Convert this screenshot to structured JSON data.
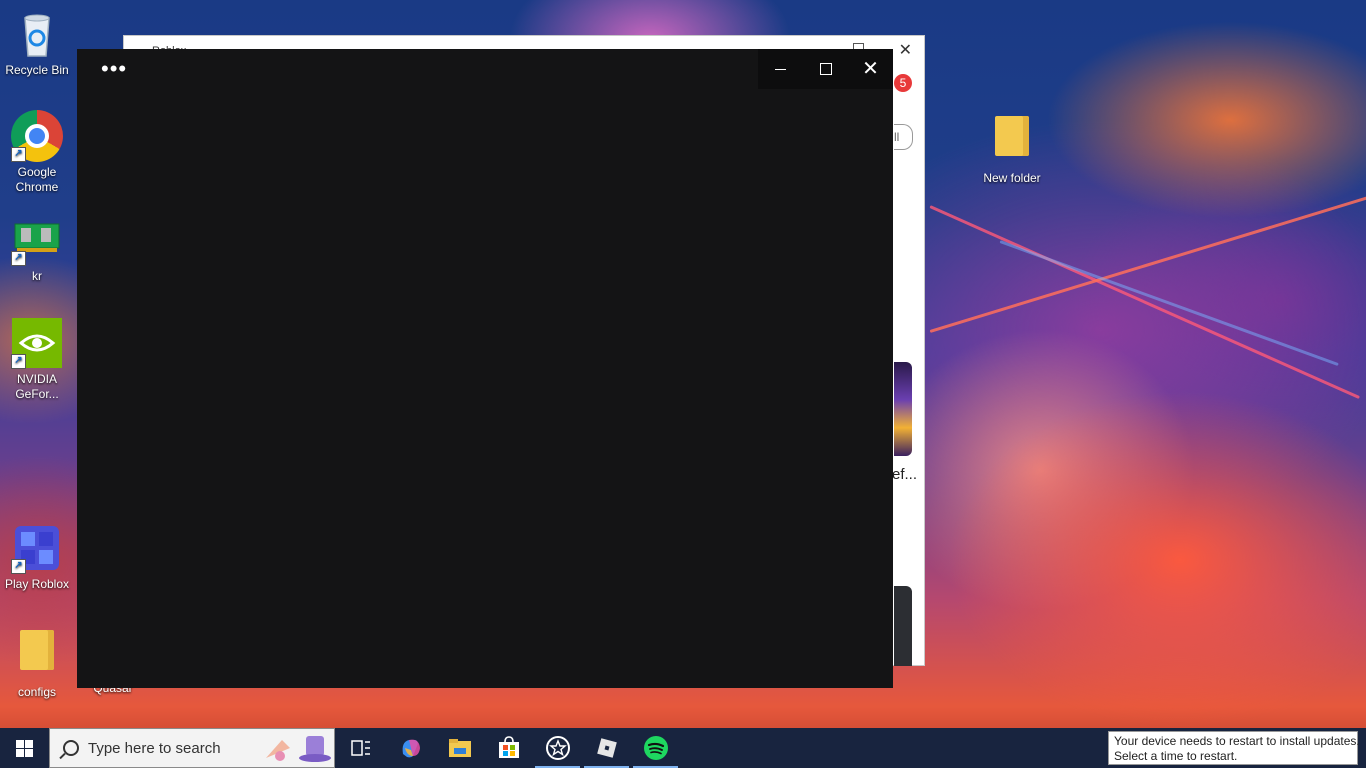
{
  "desktop": {
    "icons": [
      {
        "label": "Recycle Bin",
        "icon": "recycle-bin-icon"
      },
      {
        "label": "Google Chrome",
        "icon": "chrome-icon"
      },
      {
        "label": "kr",
        "icon": "memory-card-icon"
      },
      {
        "label": "NVIDIA GeFor...",
        "icon": "nvidia-icon"
      },
      {
        "label": "Play Roblox",
        "icon": "roblox-icon"
      },
      {
        "label": "configs",
        "icon": "folder-icon"
      },
      {
        "label": "Quasar",
        "icon": "app-icon"
      },
      {
        "label": "New folder",
        "icon": "folder-icon"
      }
    ]
  },
  "back_window": {
    "title": "Roblox",
    "notification_count": "5",
    "pill_text": "ll",
    "truncated_text": "ef..."
  },
  "front_window": {
    "menu_label": "•••",
    "minimize": "minimize",
    "maximize": "maximize",
    "close": "close"
  },
  "taskbar": {
    "search_placeholder": "Type here to search",
    "apps": [
      {
        "icon": "task-view-icon"
      },
      {
        "icon": "copilot-icon"
      },
      {
        "icon": "file-explorer-icon"
      },
      {
        "icon": "microsoft-store-icon"
      },
      {
        "icon": "star-app-icon"
      },
      {
        "icon": "roblox-icon"
      },
      {
        "icon": "spotify-icon"
      }
    ]
  },
  "notification": {
    "line1": "Your device needs to restart to install updates.",
    "line2": "Select a time to restart."
  }
}
